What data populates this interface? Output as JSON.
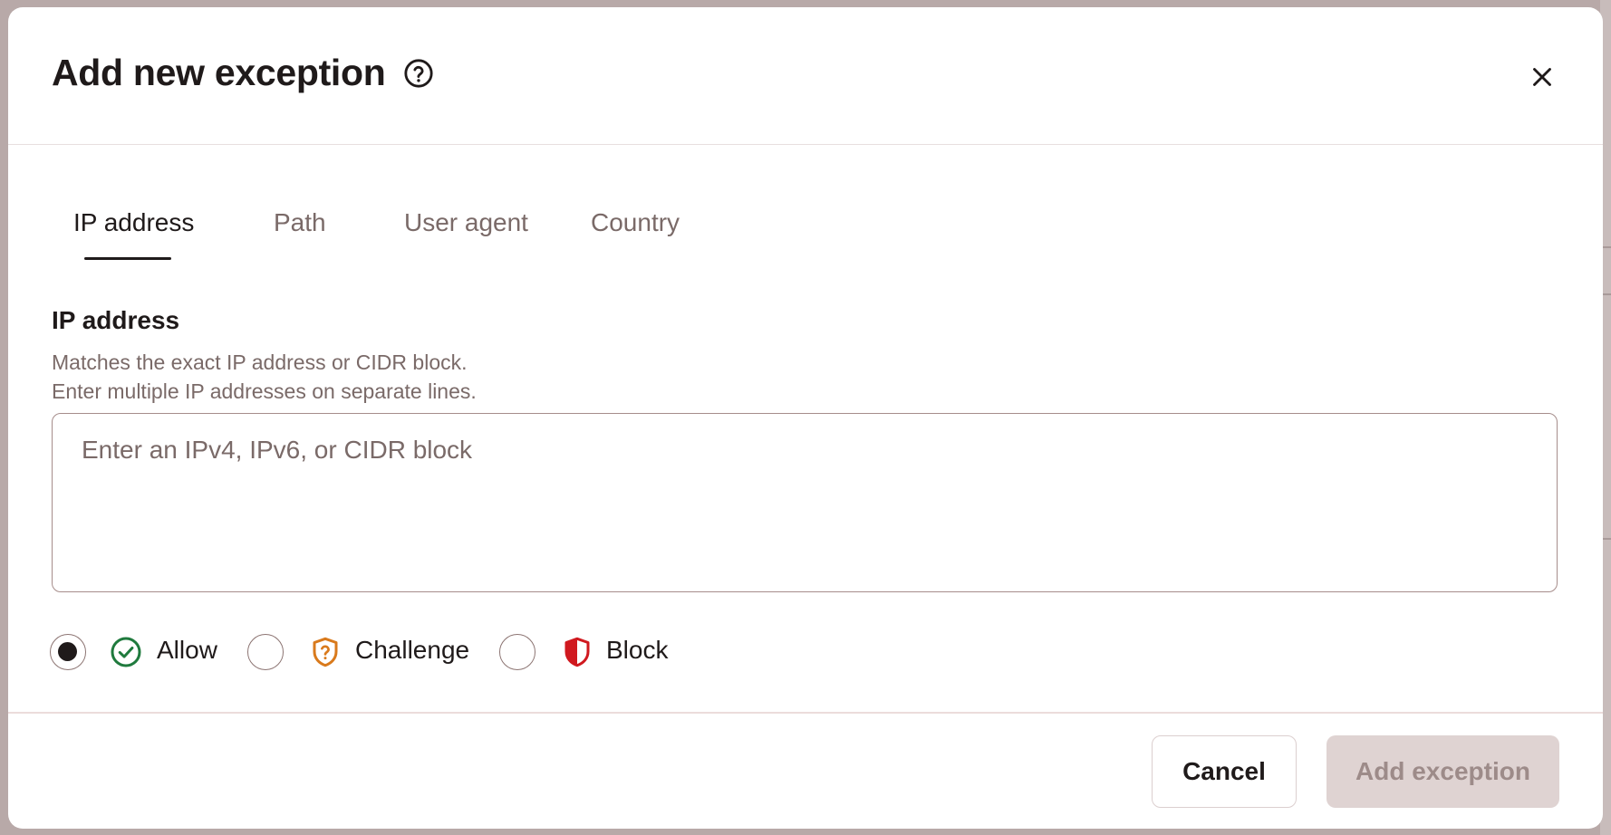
{
  "dialog": {
    "title": "Add new exception",
    "help_icon": "help-circle-icon",
    "close_icon": "close-icon"
  },
  "tabs": [
    {
      "label": "IP address",
      "active": true
    },
    {
      "label": "Path",
      "active": false
    },
    {
      "label": "User agent",
      "active": false
    },
    {
      "label": "Country",
      "active": false
    }
  ],
  "ip_field": {
    "label": "IP address",
    "help_line1": "Matches the exact IP address or CIDR block.",
    "help_line2": "Enter multiple IP addresses on separate lines.",
    "value": "",
    "placeholder": "Enter an IPv4, IPv6, or CIDR block"
  },
  "actions": [
    {
      "label": "Allow",
      "icon": "check-circle-icon",
      "color": "#1f7a3d",
      "selected": true
    },
    {
      "label": "Challenge",
      "icon": "shield-question-icon",
      "color": "#d97a1c",
      "selected": false
    },
    {
      "label": "Block",
      "icon": "shield-block-icon",
      "color": "#d0191f",
      "selected": false
    }
  ],
  "footer": {
    "cancel_label": "Cancel",
    "submit_label": "Add exception",
    "submit_disabled": true
  }
}
